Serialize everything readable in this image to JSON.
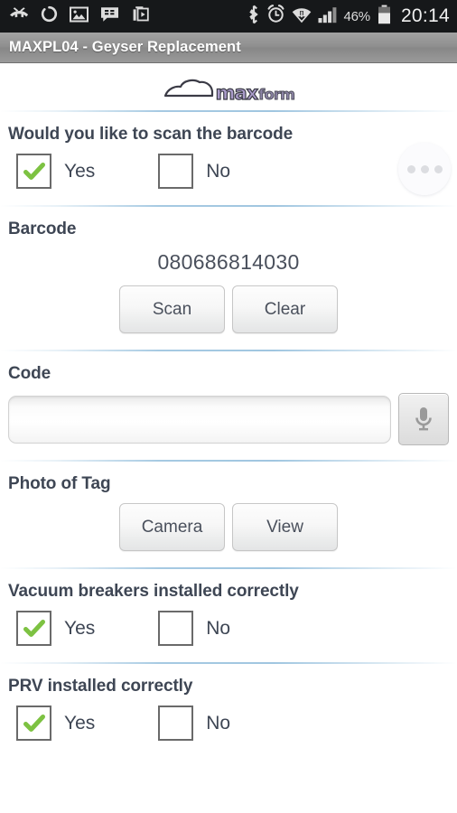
{
  "statusbar": {
    "icons_left": [
      "missed-call-icon",
      "sync-icon",
      "gallery-image-icon",
      "bbm-message-icon",
      "play-media-icon"
    ],
    "icons_right": [
      "bluetooth-icon",
      "alarm-clock-icon",
      "wifi-icon",
      "signal-bars-icon"
    ],
    "battery_percent": "46%",
    "clock": "20:14"
  },
  "titlebar": {
    "title": "MAXPL04 - Geyser Replacement"
  },
  "logo": {
    "icon": "cloud-icon",
    "text_primary": "max",
    "text_secondary": "form"
  },
  "fab": {
    "name": "overflow-menu-button",
    "dots": 3
  },
  "colors": {
    "label": "#3e4654",
    "accent_divider": "#96c0dd",
    "check_green": "#7dc242",
    "titlebar": "#8e8e8e",
    "statusbar": "#16181a"
  },
  "sections": [
    {
      "type": "checkbox",
      "label": "Would you like to scan the barcode",
      "options": [
        {
          "label": "Yes",
          "checked": true
        },
        {
          "label": "No",
          "checked": false
        }
      ]
    },
    {
      "type": "barcode",
      "label": "Barcode",
      "value": "080686814030",
      "buttons": [
        {
          "label": "Scan"
        },
        {
          "label": "Clear"
        }
      ]
    },
    {
      "type": "input",
      "label": "Code",
      "value": "",
      "placeholder": "",
      "mic_icon": "microphone-icon"
    },
    {
      "type": "photo",
      "label": "Photo of Tag",
      "buttons": [
        {
          "label": "Camera"
        },
        {
          "label": "View"
        }
      ]
    },
    {
      "type": "checkbox",
      "label": "Vacuum breakers installed correctly",
      "options": [
        {
          "label": "Yes",
          "checked": true
        },
        {
          "label": "No",
          "checked": false
        }
      ]
    },
    {
      "type": "checkbox",
      "label": "PRV installed correctly",
      "options": [
        {
          "label": "Yes",
          "checked": true
        },
        {
          "label": "No",
          "checked": false
        }
      ]
    }
  ]
}
